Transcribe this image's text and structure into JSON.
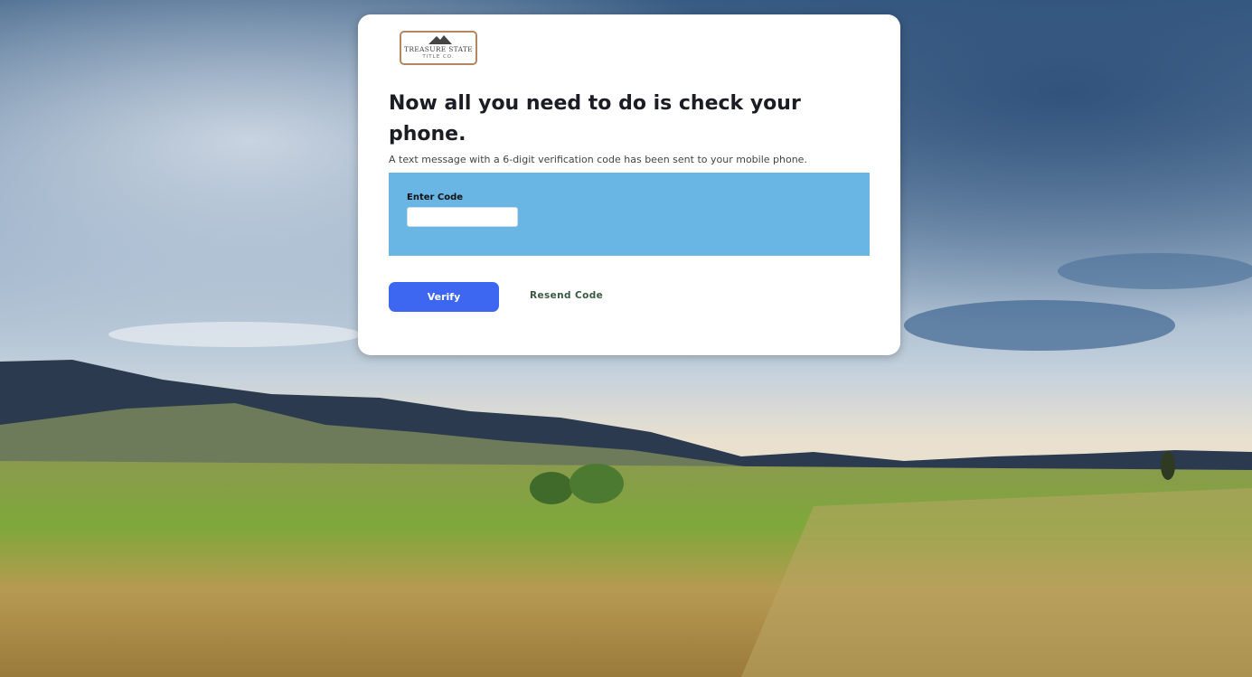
{
  "logo": {
    "name": "TREASURE STATE",
    "sub": "TITLE CO."
  },
  "headline": "Now all you need to do is check your phone.",
  "subtext": "A text message with a 6-digit verification code has been sent to your mobile phone.",
  "code": {
    "label": "Enter Code",
    "value": ""
  },
  "actions": {
    "verify_label": "Verify",
    "resend_label": "Resend Code"
  },
  "colors": {
    "panel": "#69b5e4",
    "verify_button": "#3e67f1",
    "resend_text": "#3a5a40"
  }
}
